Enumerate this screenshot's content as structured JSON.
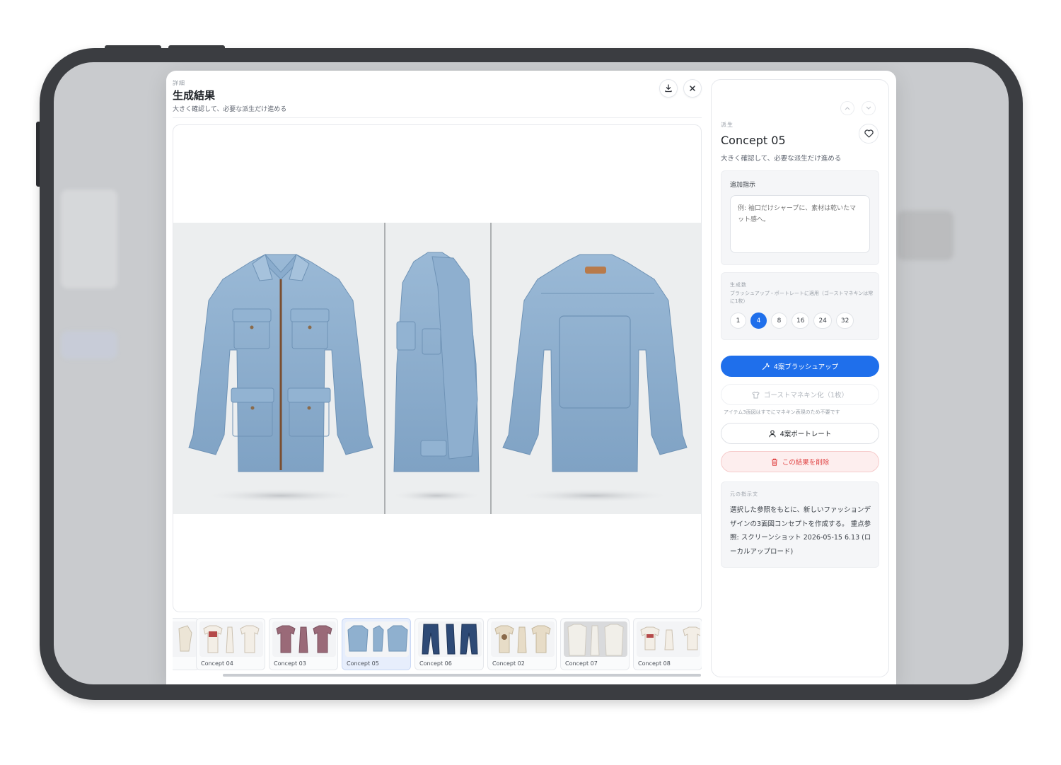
{
  "modal": {
    "eyebrow": "詳細",
    "title": "生成結果",
    "subtitle": "大きく確認して、必要な派生だけ進める",
    "download_icon": "download-icon",
    "close_icon": "close-icon"
  },
  "thumbnails": [
    {
      "label": "Concept 04",
      "active": false,
      "type": "tee"
    },
    {
      "label": "Concept 03",
      "active": false,
      "type": "tee-mauve"
    },
    {
      "label": "Concept 05",
      "active": true,
      "type": "denim-jacket"
    },
    {
      "label": "Concept 06",
      "active": false,
      "type": "jeans"
    },
    {
      "label": "Concept 02",
      "active": false,
      "type": "tee-beige"
    },
    {
      "label": "Concept 07",
      "active": false,
      "type": "shirt-white"
    },
    {
      "label": "Concept 08",
      "active": false,
      "type": "tee"
    }
  ],
  "panel": {
    "eyebrow": "派生",
    "title": "Concept 05",
    "subtitle": "大きく確認して、必要な派生だけ進める",
    "instruction_label": "追加指示",
    "instruction_placeholder": "例: 袖口だけシャープに、素材は乾いたマット感へ。",
    "count_label": "生成数",
    "count_note": "ブラッシュアップ・ポートレートに適用（ゴーストマネキンは常に1枚）",
    "counts": [
      "1",
      "4",
      "8",
      "16",
      "24",
      "32"
    ],
    "selected_count": "4",
    "brushup_label": "4案ブラッシュアップ",
    "ghost_label": "ゴーストマネキン化（1枚）",
    "ghost_hint": "アイテム3面図はすでにマネキン表現のため不要です",
    "portrait_label": "4案ポートレート",
    "delete_label": "この結果を削除",
    "prompt_label": "元の指示文",
    "prompt_text": "選択した参照をもとに、新しいファッションデザインの3面図コンセプトを作成する。 重点参照: スクリーンショット 2026-05-15 6.13 (ローカルアップロード)"
  },
  "colors": {
    "accent": "#1f6feb",
    "danger": "#e04343",
    "denim": "#8fb0cf"
  }
}
